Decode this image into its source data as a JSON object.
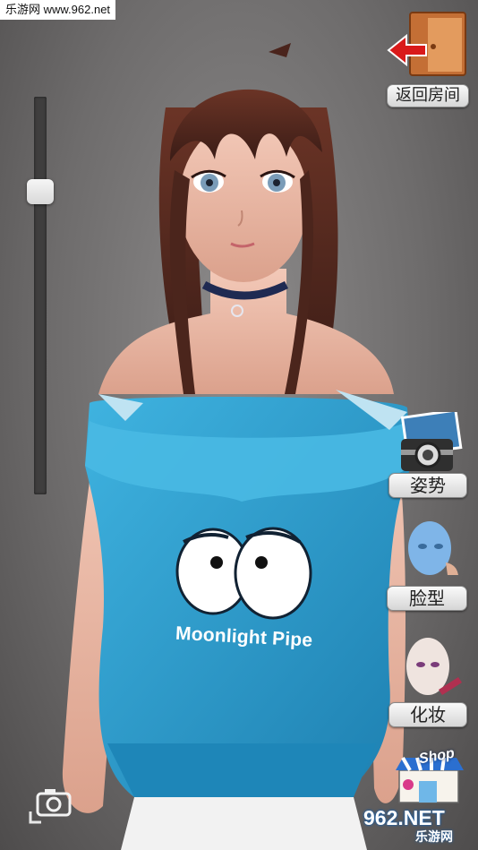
{
  "watermark_top": "乐游网 www.962.net",
  "buttons": {
    "back_room": "返回房间",
    "pose": "姿势",
    "face_shape": "脸型",
    "makeup": "化妆"
  },
  "icons": {
    "back": "door-exit-arrow-icon",
    "pose": "photo-camera-icon",
    "face": "face-model-icon",
    "makeup": "makeup-face-icon",
    "shop": "shop-icon",
    "screenshot": "camera-icon"
  },
  "shop_label": "Shop",
  "shirt_text": "Moonlight Pipe",
  "zoom_level": 0.22,
  "watermark_bottom": {
    "top": "962.NET",
    "bottom": "乐游网"
  },
  "colors": {
    "shirt": "#2a9ccd",
    "hair": "#5a2e22",
    "button_bg": "#e6e6e6"
  }
}
